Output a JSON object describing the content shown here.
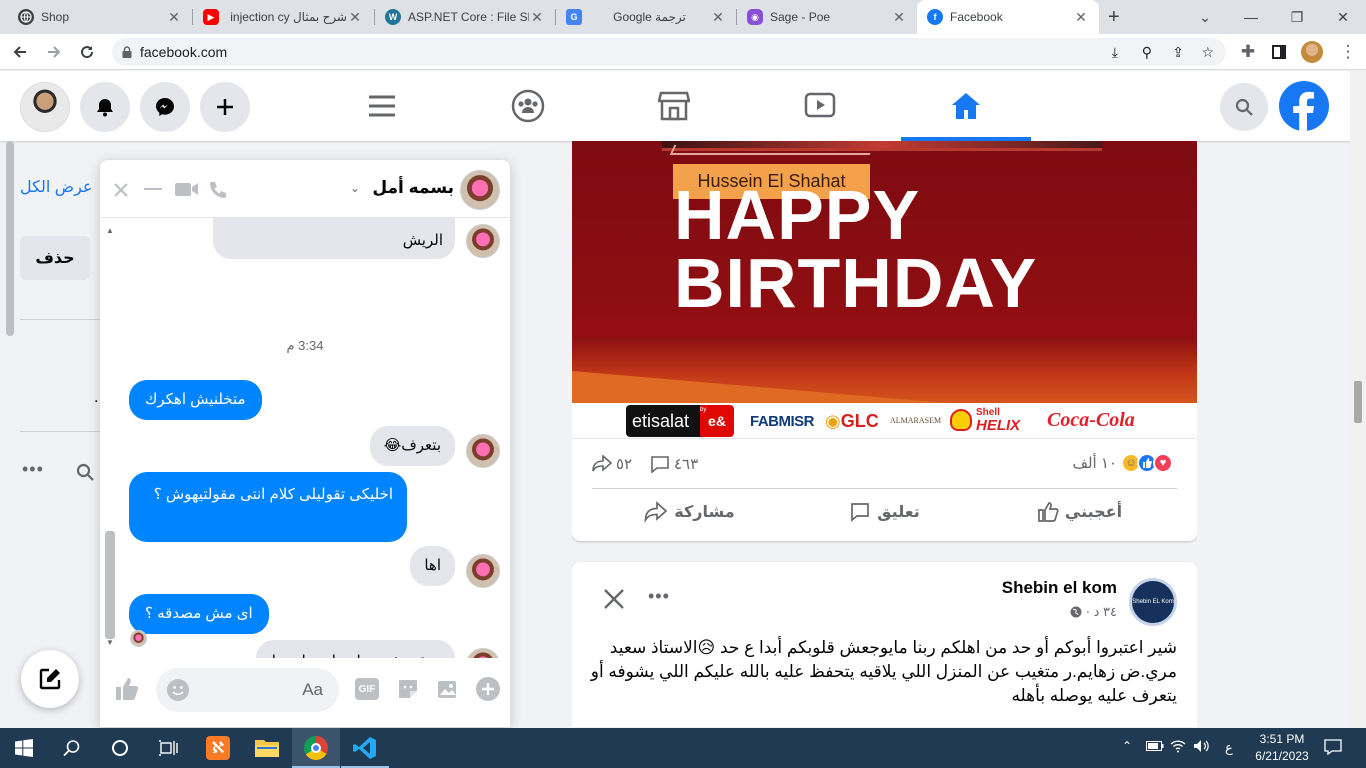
{
  "browser": {
    "tabs": [
      {
        "title": "Shop",
        "favicon": "globe-icon"
      },
      {
        "title": "شرح بمثال injection cy",
        "favicon": "youtube-icon"
      },
      {
        "title": "ASP.NET Core : File Sh",
        "favicon": "wordpress-icon"
      },
      {
        "title": "Google ترجمة",
        "favicon": "google-translate-icon"
      },
      {
        "title": "Sage - Poe",
        "favicon": "poe-icon"
      },
      {
        "title": "Facebook",
        "favicon": "facebook-icon",
        "active": true
      }
    ],
    "url": "facebook.com"
  },
  "left": {
    "see_all": "عرض الكل",
    "delete": "حذف",
    "dot": "."
  },
  "chat": {
    "contact": "بسمه أمل",
    "messages": [
      {
        "side": "in",
        "text": "الريش",
        "partial_above": "..."
      },
      {
        "type": "time",
        "text": "3:34 م"
      },
      {
        "side": "out",
        "text": "متخلنيش اهكرك"
      },
      {
        "side": "in",
        "text": "بتعرف😂"
      },
      {
        "side": "out",
        "text": "اخليكى تقوليلى كلام انتى مقولتيهوش ؟"
      },
      {
        "side": "in",
        "text": "اها"
      },
      {
        "side": "out",
        "text": "اى مش مصدقه ؟"
      },
      {
        "side": "in",
        "text": "متقدرش تعمل حاجه يا هيما"
      }
    ],
    "input_placeholder": "Aa"
  },
  "post1": {
    "name_tag": "Hussein El Shahat",
    "headline_line1": "HAPPY",
    "headline_line2": "BIRTHDAY",
    "sponsors": {
      "etisalat": "etisalat",
      "by": "by",
      "e_and": "e&",
      "fabmisr": "FABMISR",
      "glc": "GLC",
      "almarasem": "ALMARASEM",
      "shell": "Shell",
      "helix": "HELIX",
      "cocacola": "Coca-Cola"
    },
    "reactions_count": "١٠ ألف",
    "comments_count": "٤٦٣",
    "shares_count": "٥٢",
    "like_label": "أعجبني",
    "comment_label": "تعليق",
    "share_label": "مشاركة"
  },
  "post2": {
    "page_name": "Shebin el kom",
    "avatar_text": "Shebin EL Kom",
    "time": "٣٤ د ·",
    "text": "شير اعتبروا أبوكم أو حد من اهلكم ربنا مايوجعش قلوبكم  أبدا ع حد 😥الاستاذ سعيد مري.ض زهايم.ر متغيب عن المنزل اللي يلاقيه يتحفظ عليه بالله عليكم اللي يشوفه أو يتعرف عليه يوصله بأهله"
  },
  "taskbar": {
    "time": "3:51 PM",
    "date": "6/21/2023",
    "lang": "ع"
  },
  "colors": {
    "fb_blue": "#1877f2",
    "messenger_blue": "#0084ff",
    "banner_red": "#8c0e12",
    "name_tag_orange": "#f3a24b"
  }
}
